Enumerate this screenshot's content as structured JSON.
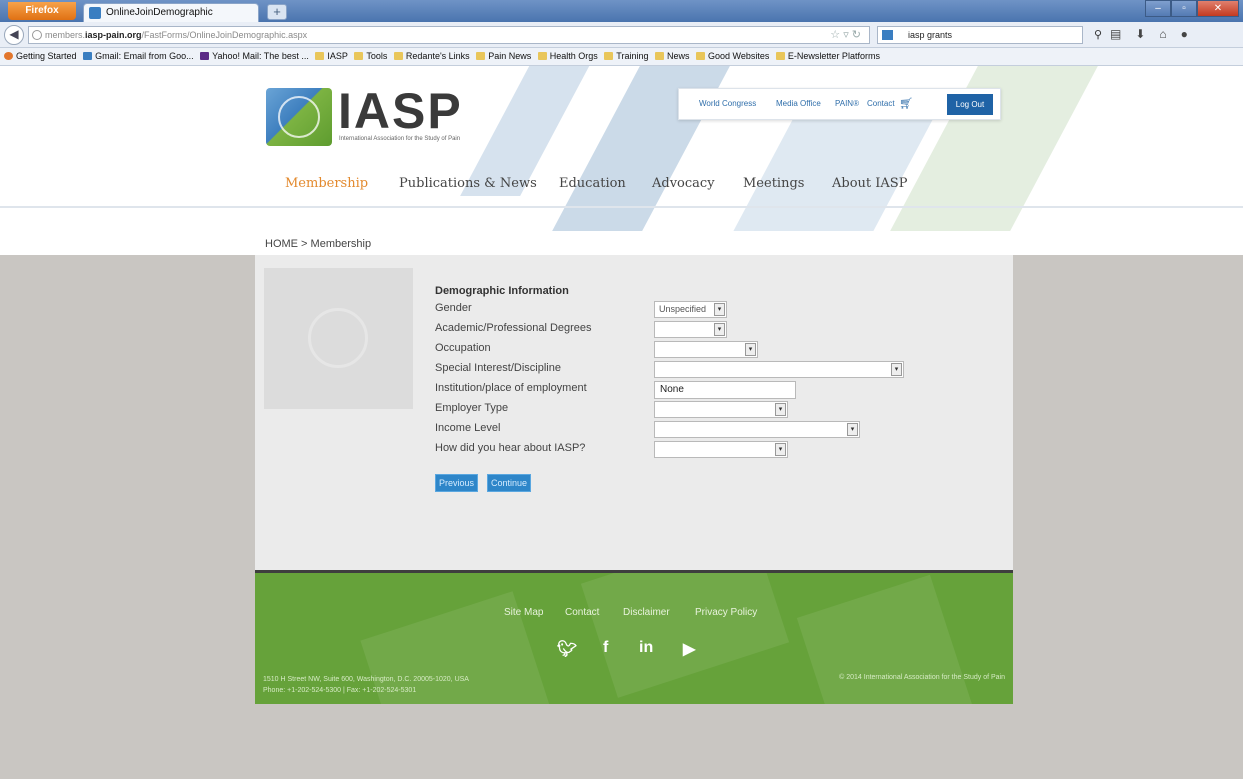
{
  "browser": {
    "menu_button": "Firefox",
    "tab_title": "OnlineJoinDemographic",
    "new_tab": "+",
    "url_prefix": "members.",
    "url_host": "iasp-pain.org",
    "url_path": "/FastForms/OnlineJoinDemographic.aspx",
    "search_value": "iasp grants",
    "bookmarks": [
      "Getting Started",
      "Gmail: Email from Goo...",
      "Yahoo! Mail: The best ...",
      "IASP",
      "Tools",
      "Redante's Links",
      "Pain News",
      "Health Orgs",
      "Training",
      "News",
      "Good Websites",
      "E-Newsletter Platforms"
    ]
  },
  "site": {
    "logo_text": "IASP",
    "logo_subtitle": "International Association for the Study of Pain",
    "utility_nav": [
      "World Congress",
      "Media Office",
      "PAIN®",
      "Contact"
    ],
    "logout_label": "Log Out",
    "main_nav": [
      "Membership",
      "Publications & News",
      "Education",
      "Advocacy",
      "Meetings",
      "About IASP"
    ],
    "active_nav": "Membership",
    "breadcrumb": "HOME > Membership"
  },
  "form": {
    "title": "Demographic Information",
    "fields": [
      {
        "label": "Gender",
        "type": "select",
        "value": "Unspecified"
      },
      {
        "label": "Academic/Professional Degrees",
        "type": "select",
        "value": ""
      },
      {
        "label": "Occupation",
        "type": "select",
        "value": ""
      },
      {
        "label": "Special Interest/Discipline",
        "type": "select",
        "value": ""
      },
      {
        "label": "Institution/place of employment",
        "type": "text",
        "value": "None"
      },
      {
        "label": "Employer Type",
        "type": "select",
        "value": ""
      },
      {
        "label": "Income Level",
        "type": "select",
        "value": ""
      },
      {
        "label": "How did you hear about IASP?",
        "type": "select",
        "value": ""
      }
    ],
    "previous_label": "Previous",
    "continue_label": "Continue"
  },
  "footer": {
    "links": [
      "Site Map",
      "Contact",
      "Disclaimer",
      "Privacy Policy"
    ],
    "social": [
      "twitter-icon",
      "facebook-icon",
      "linkedin-icon",
      "youtube-icon"
    ],
    "address_line1": "1510 H Street NW, Suite 600, Washington, D.C. 20005-1020, USA",
    "address_line2": "Phone: +1-202-524-5300 | Fax: +1-202-524-5301",
    "copyright": "© 2014 International Association for the Study of Pain"
  },
  "colors": {
    "brand_blue": "#1f63a6",
    "active_nav": "#e38a2e",
    "footer_green": "#66a23a",
    "button_blue": "#2e86c9"
  }
}
